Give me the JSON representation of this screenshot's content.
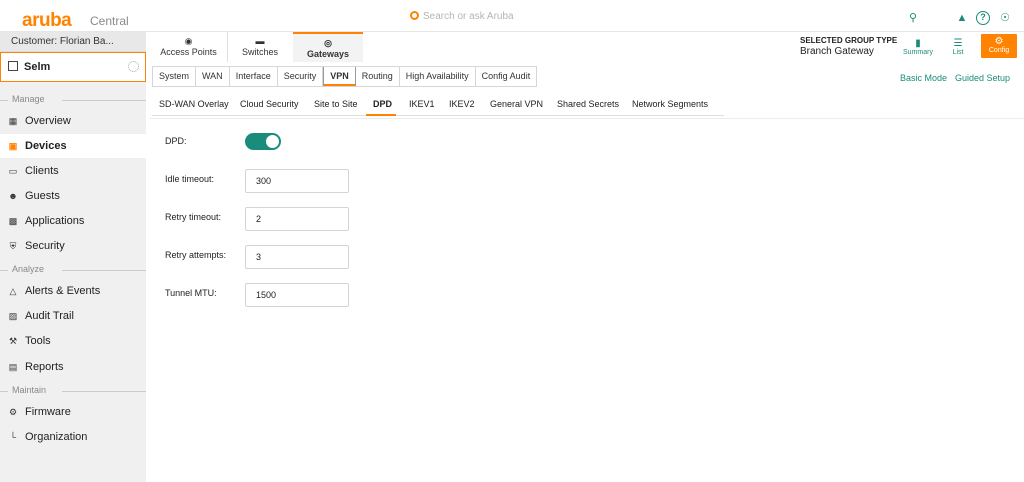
{
  "header": {
    "logo": "aruba",
    "product": "Central",
    "search_placeholder": "Search or ask Aruba",
    "icons": [
      "search-icon",
      "bell-icon",
      "help-icon",
      "user-icon"
    ]
  },
  "sidebar": {
    "customer": "Customer: Florian Ba...",
    "site": "Selm",
    "sections": {
      "manage": "Manage",
      "analyze": "Analyze",
      "maintain": "Maintain"
    },
    "items": [
      {
        "label": "Overview",
        "icon": "grid-icon"
      },
      {
        "label": "Devices",
        "icon": "devices-icon",
        "active": true
      },
      {
        "label": "Clients",
        "icon": "clients-icon"
      },
      {
        "label": "Guests",
        "icon": "guests-icon"
      },
      {
        "label": "Applications",
        "icon": "applications-icon"
      },
      {
        "label": "Security",
        "icon": "shield-icon"
      },
      {
        "label": "Alerts & Events",
        "icon": "bell-icon"
      },
      {
        "label": "Audit Trail",
        "icon": "audit-icon"
      },
      {
        "label": "Tools",
        "icon": "wrench-icon"
      },
      {
        "label": "Reports",
        "icon": "reports-icon"
      },
      {
        "label": "Firmware",
        "icon": "firmware-icon"
      },
      {
        "label": "Organization",
        "icon": "organization-icon"
      }
    ]
  },
  "device_tabs": [
    {
      "label": "Access Points"
    },
    {
      "label": "Switches"
    },
    {
      "label": "Gateways",
      "active": true
    }
  ],
  "group": {
    "label": "SELECTED GROUP TYPE",
    "value": "Branch Gateway",
    "summary": "Summary",
    "list": "List",
    "config": "Config"
  },
  "config_tabs": [
    "System",
    "WAN",
    "Interface",
    "Security",
    "VPN",
    "Routing",
    "High Availability",
    "Config Audit"
  ],
  "config_active": "VPN",
  "links": {
    "basic": "Basic Mode",
    "guided": "Guided Setup"
  },
  "vpn_tabs": [
    "SD-WAN Overlay",
    "Cloud Security",
    "Site to Site",
    "DPD",
    "IKEV1",
    "IKEV2",
    "General VPN",
    "Shared Secrets",
    "Network Segments"
  ],
  "vpn_active": "DPD",
  "form": {
    "dpd_label": "DPD:",
    "dpd_enabled": true,
    "idle_label": "Idle timeout:",
    "idle_value": "300",
    "retry_label": "Retry timeout:",
    "retry_value": "2",
    "attempts_label": "Retry attempts:",
    "attempts_value": "3",
    "mtu_label": "Tunnel MTU:",
    "mtu_value": "1500"
  },
  "colors": {
    "brand": "#ff8300",
    "accent": "#1a8c7b"
  }
}
